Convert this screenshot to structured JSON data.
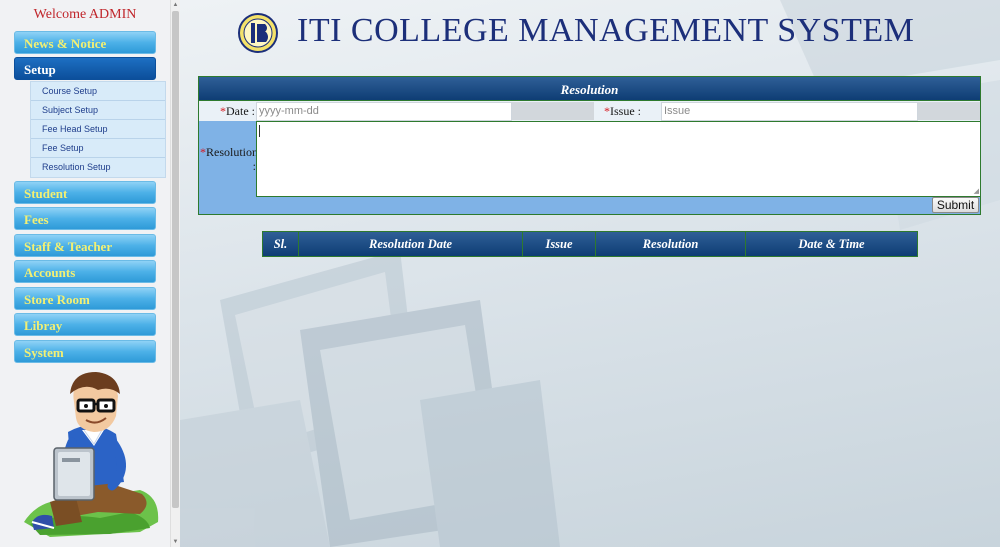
{
  "sidebar": {
    "welcome": "Welcome ADMIN",
    "items": [
      {
        "label": "News & Notice"
      },
      {
        "label": "Setup"
      },
      {
        "label": "Student"
      },
      {
        "label": "Fees"
      },
      {
        "label": "Staff & Teacher"
      },
      {
        "label": "Accounts"
      },
      {
        "label": "Store Room"
      },
      {
        "label": "Libray"
      },
      {
        "label": "System"
      }
    ],
    "submenu": [
      {
        "label": "Course Setup"
      },
      {
        "label": "Subject Setup"
      },
      {
        "label": "Fee Head Setup"
      },
      {
        "label": "Fee Setup"
      },
      {
        "label": "Resolution Setup"
      }
    ],
    "illustration_icon": "student-with-laptop-illustration"
  },
  "header": {
    "title": "ITI COLLEGE MANAGEMENT SYSTEM",
    "logo_icon": "college-logo-icon"
  },
  "form": {
    "title": "Resolution",
    "date_label": "Date :",
    "date_placeholder": "yyyy-mm-dd",
    "issue_label": "Issue :",
    "issue_placeholder": "Issue",
    "resolution_label": "Resolution :",
    "required_mark": "*",
    "submit_label": "Submit"
  },
  "table": {
    "headers": [
      "Sl.",
      "Resolution Date",
      "Issue",
      "Resolution",
      "Date & Time"
    ]
  },
  "colors": {
    "header_title": "#1c2f7a",
    "table_header": "#0e3d74",
    "nav_button": "#4db1e8",
    "nav_active": "#0c4f9b",
    "nav_text": "#f3f073",
    "required": "#d7161d"
  }
}
